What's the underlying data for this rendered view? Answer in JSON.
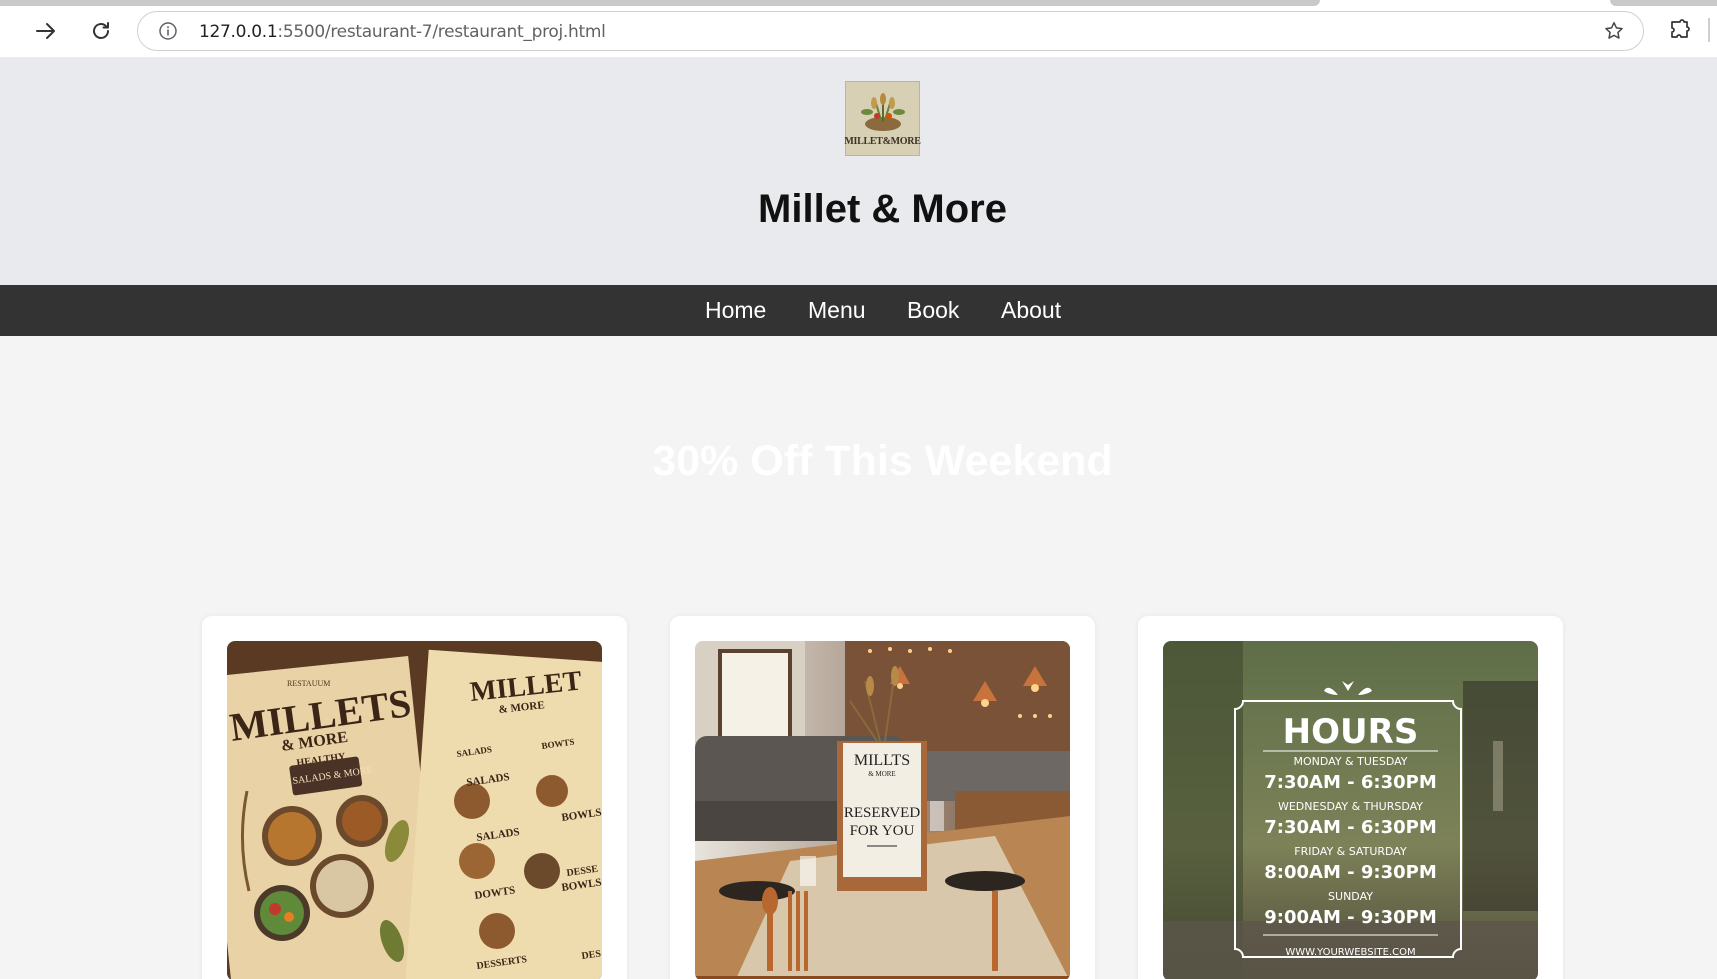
{
  "browser": {
    "url_host": "127.0.0.1",
    "url_rest": ":5500/restaurant-7/restaurant_proj.html"
  },
  "header": {
    "logo_text": "MILLET&MORE",
    "title": "Millet & More"
  },
  "nav": {
    "items": [
      {
        "label": "Home"
      },
      {
        "label": "Menu"
      },
      {
        "label": "Book"
      },
      {
        "label": "About"
      }
    ]
  },
  "promo": {
    "text": "30% Off This Weekend"
  },
  "cards": [
    {
      "menu_left": {
        "small": "RESTAUUM",
        "title1": "MILLETS",
        "title2": "& MORE",
        "sub": "HEALTHY",
        "tag": "SALADS & MORE"
      },
      "menu_right": {
        "title1": "MILLET",
        "title2": "& MORE",
        "labels": [
          "SALADS",
          "BOWTS",
          "SALADS",
          "BOWLS",
          "SALADS",
          "BOWLS",
          "DOWTS",
          "DESSE",
          "DESSERTS",
          "DES"
        ]
      }
    },
    {
      "sign_top": "MILLTS",
      "sign_sub": "& MORE",
      "sign_line1": "RESERVED",
      "sign_line2": "FOR YOU"
    },
    {
      "heading": "HOURS",
      "rows": [
        {
          "days": "MONDAY & TUESDAY",
          "time": "7:30AM - 6:30PM"
        },
        {
          "days": "WEDNESDAY & THURSDAY",
          "time": "7:30AM - 6:30PM"
        },
        {
          "days": "FRIDAY & SATURDAY",
          "time": "8:00AM - 9:30PM"
        },
        {
          "days": "SUNDAY",
          "time": "9:00AM - 9:30PM"
        }
      ],
      "website": "WWW.YOURWEBSITE.COM"
    }
  ],
  "colors": {
    "header_bg": "#e8eaed",
    "nav_bg": "#333333",
    "page_bg": "#f4f4f4"
  }
}
